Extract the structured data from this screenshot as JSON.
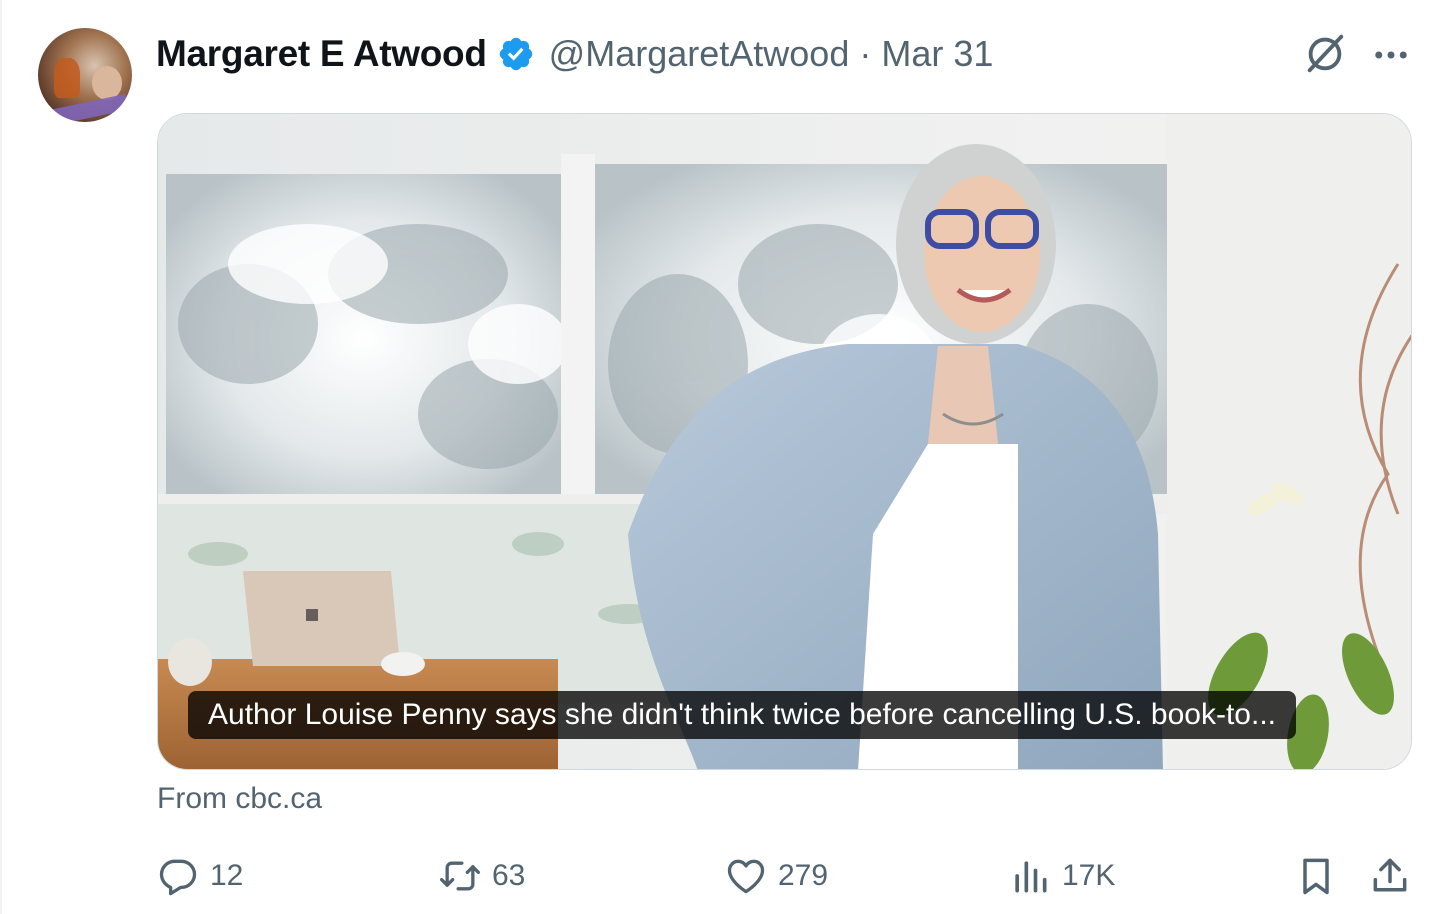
{
  "author": {
    "display_name": "Margaret E Atwood",
    "handle": "@MargaretAtwood",
    "separator": "·",
    "date": "Mar 31",
    "verified": true,
    "verified_color": "#1d9bf0"
  },
  "icons": {
    "avatar": "avatar-photo",
    "verified": "verified-badge-icon",
    "grok": "grok-icon",
    "more": "more-options-icon",
    "reply": "reply-icon",
    "retweet": "retweet-icon",
    "like": "like-icon",
    "views": "views-icon",
    "bookmark": "bookmark-icon",
    "share": "share-icon"
  },
  "card": {
    "caption": "Author Louise Penny says she didn't think twice before cancelling U.S. book-to...",
    "source": "From cbc.ca"
  },
  "actions": {
    "replies": "12",
    "retweets": "63",
    "likes": "279",
    "views": "17K"
  },
  "colors": {
    "text_primary": "#0f1419",
    "text_secondary": "#536471",
    "border": "#cfd9de"
  }
}
